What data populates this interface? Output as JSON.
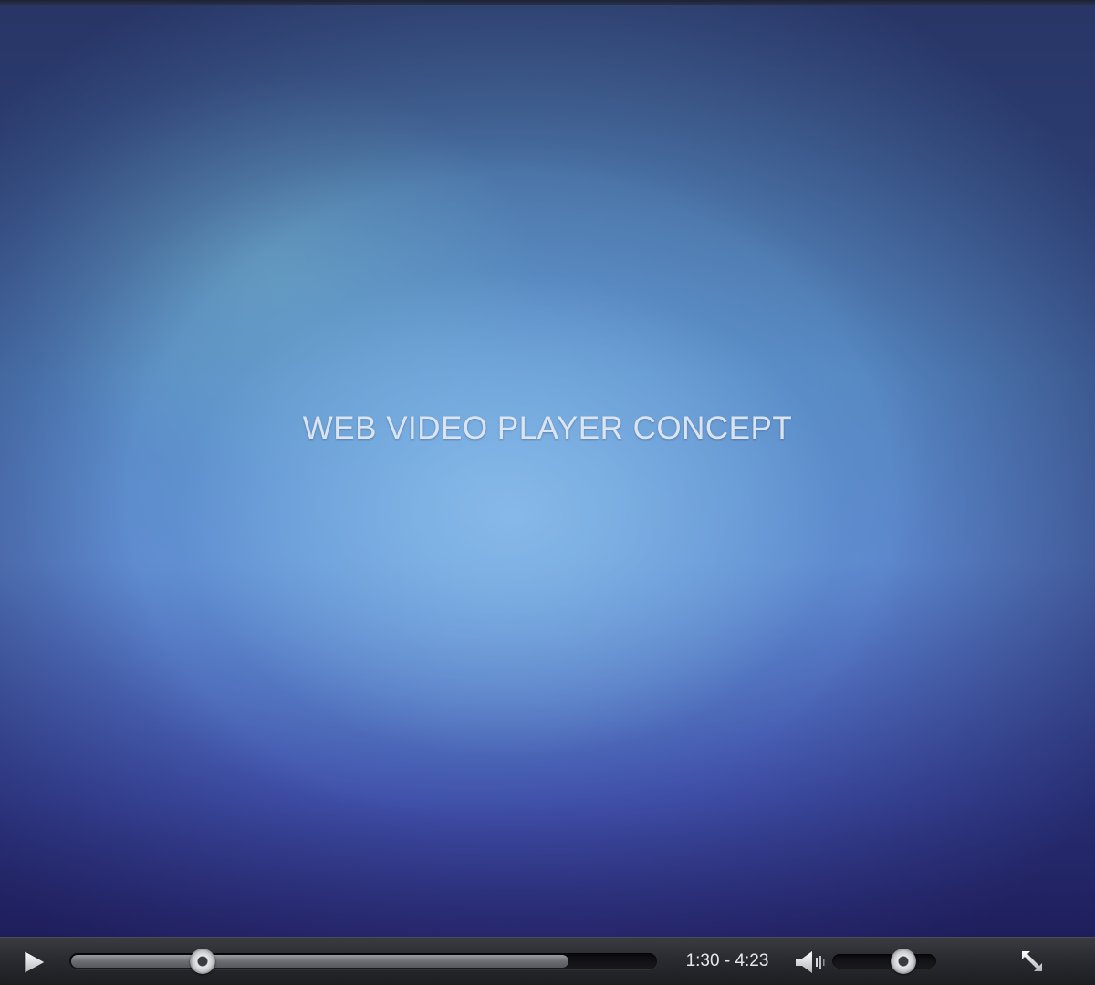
{
  "video": {
    "title": "WEB VIDEO PLAYER CONCEPT"
  },
  "controls": {
    "play_icon": "play-icon",
    "volume_icon": "speaker-icon",
    "fullscreen_icon": "fullscreen-expand-icon",
    "time": {
      "current": "1:30",
      "separator": " - ",
      "total": "4:23"
    },
    "playback_progress": 0.227,
    "buffered_progress": 0.852,
    "volume_level": 0.68
  },
  "colors": {
    "control_bar": "#2a2b30",
    "time_text": "#e6e7ea",
    "title_text": "#e6ecf5"
  }
}
